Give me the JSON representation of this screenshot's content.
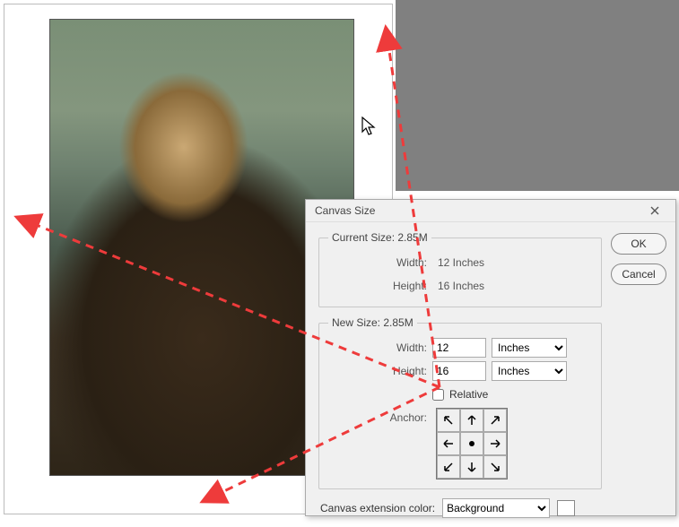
{
  "dialog": {
    "title": "Canvas Size",
    "ok_label": "OK",
    "cancel_label": "Cancel",
    "current_size": {
      "legend": "Current Size: 2.85M",
      "width_label": "Width:",
      "width_value": "12 Inches",
      "height_label": "Height:",
      "height_value": "16 Inches"
    },
    "new_size": {
      "legend": "New Size: 2.85M",
      "width_label": "Width:",
      "width_value": "12",
      "width_unit": "Inches",
      "height_label": "Height:",
      "height_value": "16",
      "height_unit": "Inches",
      "relative_label": "Relative",
      "relative_checked": false,
      "anchor_label": "Anchor:"
    },
    "extension": {
      "label": "Canvas extension color:",
      "value": "Background"
    }
  },
  "annotation_color": "#ee3b3b"
}
